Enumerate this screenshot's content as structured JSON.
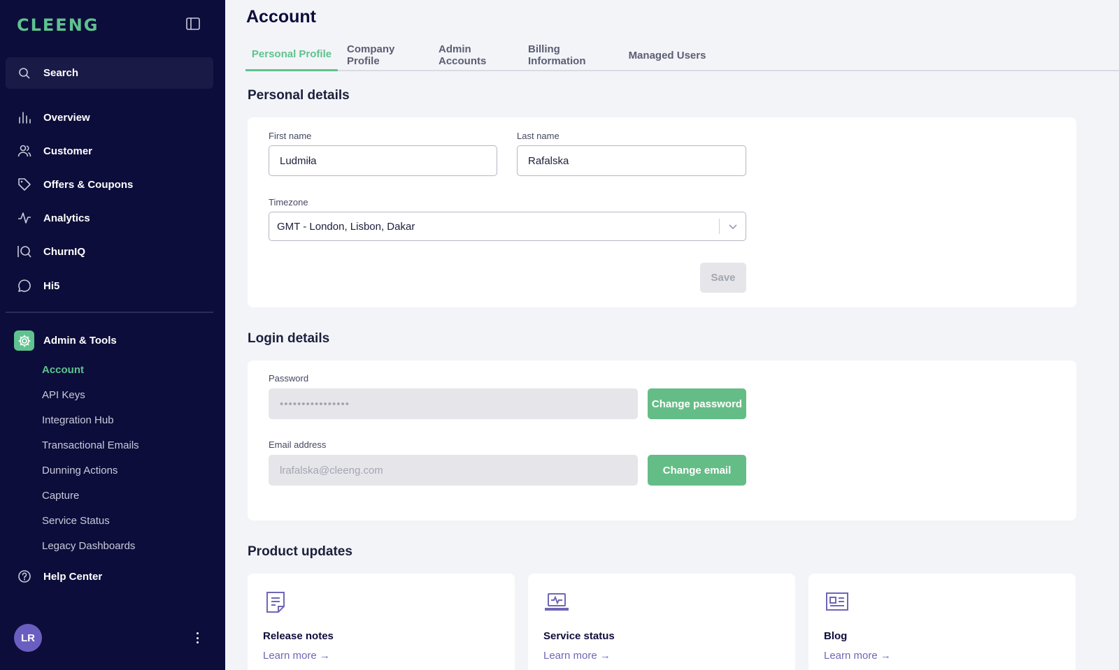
{
  "brand": {
    "logo_text": "CLEENG",
    "accent": "#5ec38e",
    "sidebar_bg": "#0d0d3b"
  },
  "sidebar": {
    "search_label": "Search",
    "nav": [
      {
        "label": "Overview",
        "icon": "bar-chart-icon"
      },
      {
        "label": "Customer",
        "icon": "users-icon"
      },
      {
        "label": "Offers & Coupons",
        "icon": "tag-icon"
      },
      {
        "label": "Analytics",
        "icon": "pulse-icon"
      },
      {
        "label": "ChurnIQ",
        "icon": "churniq-icon"
      },
      {
        "label": "Hi5",
        "icon": "chat-bubble-icon"
      }
    ],
    "admin_label": "Admin & Tools",
    "admin_items": [
      {
        "label": "Account",
        "active": true
      },
      {
        "label": "API Keys"
      },
      {
        "label": "Integration Hub"
      },
      {
        "label": "Transactional Emails"
      },
      {
        "label": "Dunning Actions"
      },
      {
        "label": "Capture"
      },
      {
        "label": "Service Status"
      },
      {
        "label": "Legacy Dashboards"
      }
    ],
    "help_label": "Help Center",
    "user_initials": "LR"
  },
  "header": {
    "title": "Account",
    "tabs": [
      {
        "label": "Personal Profile",
        "active": true
      },
      {
        "label": "Company Profile"
      },
      {
        "label": "Admin Accounts"
      },
      {
        "label": "Billing Information"
      },
      {
        "label": "Managed Users"
      }
    ]
  },
  "personal": {
    "section_title": "Personal details",
    "first_name_label": "First name",
    "first_name_value": "Ludmiła",
    "last_name_label": "Last name",
    "last_name_value": "Rafalska",
    "timezone_label": "Timezone",
    "timezone_value": "GMT - London, Lisbon, Dakar",
    "save_label": "Save"
  },
  "login": {
    "section_title": "Login details",
    "password_label": "Password",
    "password_value": "••••••••••••••••",
    "change_password_label": "Change password",
    "email_label": "Email address",
    "email_value": "lrafalska@cleeng.com",
    "change_email_label": "Change email"
  },
  "updates": {
    "section_title": "Product updates",
    "cards": [
      {
        "title": "Release notes",
        "link": "Learn more →",
        "icon": "document-icon"
      },
      {
        "title": "Service status",
        "link": "Learn more →",
        "icon": "laptop-pulse-icon"
      },
      {
        "title": "Blog",
        "link": "Learn more →",
        "icon": "newspaper-icon"
      }
    ]
  }
}
